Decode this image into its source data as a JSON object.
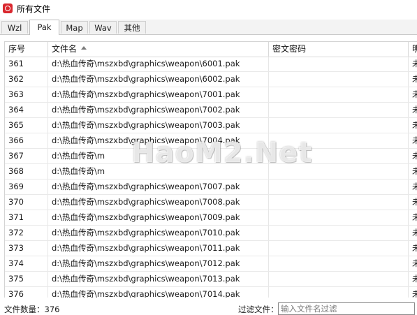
{
  "window": {
    "title": "所有文件"
  },
  "tabs": [
    {
      "label": "Wzl",
      "active": false
    },
    {
      "label": "Pak",
      "active": true
    },
    {
      "label": "Map",
      "active": false
    },
    {
      "label": "Wav",
      "active": false
    },
    {
      "label": "其他",
      "active": false
    }
  ],
  "table": {
    "columns": [
      "序号",
      "文件名",
      "密文密码",
      "明"
    ],
    "rows": [
      {
        "index": "361",
        "file": "d:\\热血传奇\\mszxbd\\graphics\\weapon\\6001.pak",
        "status": "未"
      },
      {
        "index": "362",
        "file": "d:\\热血传奇\\mszxbd\\graphics\\weapon\\6002.pak",
        "status": "未"
      },
      {
        "index": "363",
        "file": "d:\\热血传奇\\mszxbd\\graphics\\weapon\\7001.pak",
        "status": "未"
      },
      {
        "index": "364",
        "file": "d:\\热血传奇\\mszxbd\\graphics\\weapon\\7002.pak",
        "status": "未"
      },
      {
        "index": "365",
        "file": "d:\\热血传奇\\mszxbd\\graphics\\weapon\\7003.pak",
        "status": "未"
      },
      {
        "index": "366",
        "file": "d:\\热血传奇\\mszxbd\\graphics\\weapon\\7004.pak",
        "status": "未"
      },
      {
        "index": "367",
        "file": "d:\\热血传奇\\m",
        "status": "未"
      },
      {
        "index": "368",
        "file": "d:\\热血传奇\\m",
        "status": "未"
      },
      {
        "index": "369",
        "file": "d:\\热血传奇\\mszxbd\\graphics\\weapon\\7007.pak",
        "status": "未"
      },
      {
        "index": "370",
        "file": "d:\\热血传奇\\mszxbd\\graphics\\weapon\\7008.pak",
        "status": "未"
      },
      {
        "index": "371",
        "file": "d:\\热血传奇\\mszxbd\\graphics\\weapon\\7009.pak",
        "status": "未"
      },
      {
        "index": "372",
        "file": "d:\\热血传奇\\mszxbd\\graphics\\weapon\\7010.pak",
        "status": "未"
      },
      {
        "index": "373",
        "file": "d:\\热血传奇\\mszxbd\\graphics\\weapon\\7011.pak",
        "status": "未"
      },
      {
        "index": "374",
        "file": "d:\\热血传奇\\mszxbd\\graphics\\weapon\\7012.pak",
        "status": "未"
      },
      {
        "index": "375",
        "file": "d:\\热血传奇\\mszxbd\\graphics\\weapon\\7013.pak",
        "status": "未"
      },
      {
        "index": "376",
        "file": "d:\\热血传奇\\mszxbd\\graphics\\weapon\\7014.pak",
        "status": "未"
      }
    ]
  },
  "watermark": "HaoM2.Net",
  "footer": {
    "count_label": "文件数量：376",
    "filter_label": "过滤文件：",
    "filter_placeholder": "输入文件名过滤",
    "filter_value": ""
  },
  "colors": {
    "app_icon": "#d9272e"
  }
}
